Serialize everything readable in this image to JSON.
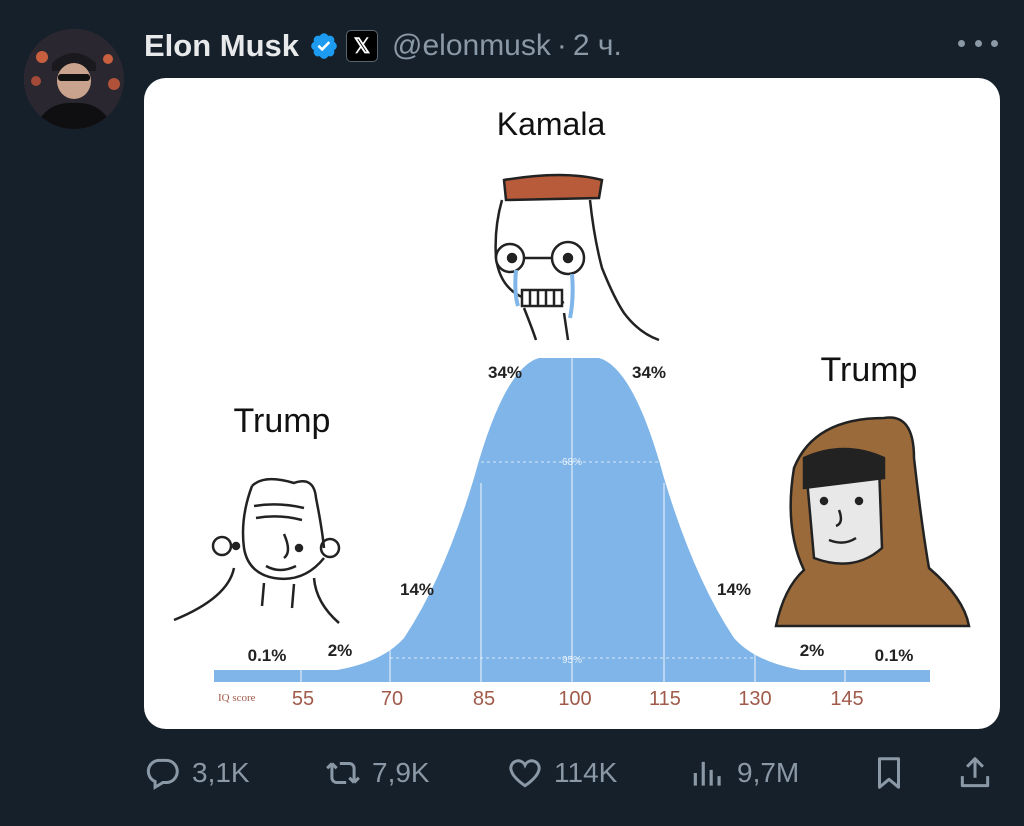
{
  "post": {
    "author_name": "Elon Musk",
    "verified_icon": "verified-badge-icon",
    "x_badge": "𝕏",
    "handle": "@elonmusk",
    "separator": "·",
    "time": "2 ч."
  },
  "media": {
    "top_label": "Kamala",
    "left_label": "Trump",
    "right_label": "Trump",
    "percent_labels": {
      "left_0_1": "0.1%",
      "left_2": "2%",
      "left_14": "14%",
      "left_34": "34%",
      "right_34": "34%",
      "right_14": "14%",
      "right_2": "2%",
      "right_0_1": "0.1%",
      "center_68": "68%",
      "center_95": "95%"
    },
    "axis_title": "IQ score",
    "axis_ticks": [
      "55",
      "70",
      "85",
      "100",
      "115",
      "130",
      "145"
    ]
  },
  "actions": {
    "replies": "3,1K",
    "reposts": "7,9K",
    "likes": "114K",
    "views": "9,7M"
  },
  "colors": {
    "background": "#15202b",
    "curve_fill": "#7fb5e8",
    "verified": "#1d9bf0"
  }
}
